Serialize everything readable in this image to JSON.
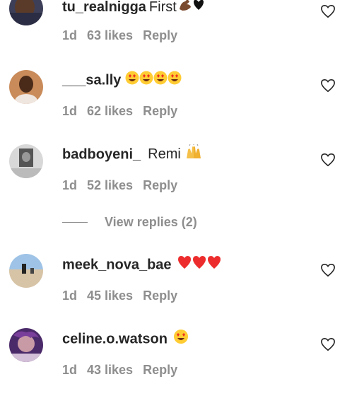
{
  "comments": [
    {
      "username": "tu_realnigga",
      "text": "First",
      "emoji": "💪🏾❤",
      "time": "1d",
      "likes": "63 likes",
      "reply": "Reply",
      "avatar_icon": "profile-photo"
    },
    {
      "username": "___sa.lly",
      "text": "",
      "emoji": "😍😍😍😍",
      "time": "1d",
      "likes": "62 likes",
      "reply": "Reply",
      "avatar_icon": "profile-photo"
    },
    {
      "username": "badboyeni_",
      "text": "Remi",
      "emoji": "🙌",
      "time": "1d",
      "likes": "52 likes",
      "reply": "Reply",
      "avatar_icon": "profile-photo"
    },
    {
      "username": "meek_nova_bae",
      "text": "",
      "emoji": "❤️❤️❤️",
      "time": "1d",
      "likes": "45 likes",
      "reply": "Reply",
      "avatar_icon": "profile-photo"
    },
    {
      "username": "celine.o.watson",
      "text": "",
      "emoji": "😍",
      "time": "1d",
      "likes": "43 likes",
      "reply": "Reply",
      "avatar_icon": "profile-photo"
    }
  ],
  "view_replies": "View replies (2)",
  "colors": {
    "text": "#262626",
    "secondary": "#8e8e8e",
    "heart_red": "#ed2d2d"
  }
}
